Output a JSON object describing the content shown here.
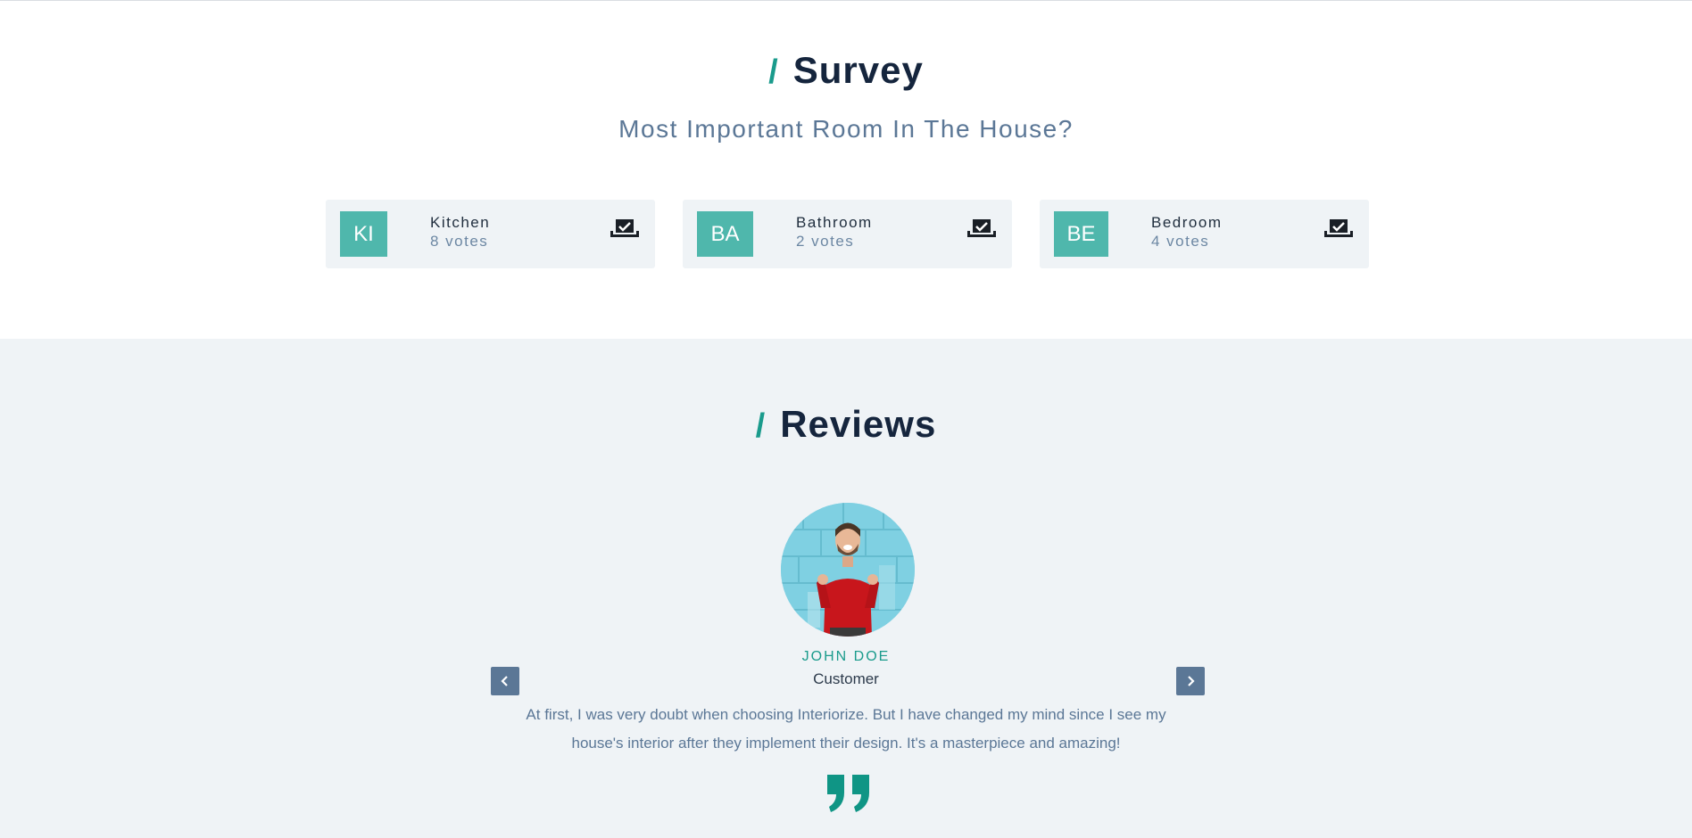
{
  "survey": {
    "slash": "/",
    "title": "Survey",
    "question": "Most Important Room In The House?",
    "options": [
      {
        "initials": "KI",
        "name": "Kitchen",
        "votes": "8 votes"
      },
      {
        "initials": "BA",
        "name": "Bathroom",
        "votes": "2 votes"
      },
      {
        "initials": "BE",
        "name": "Bedroom",
        "votes": "4 votes"
      }
    ]
  },
  "reviews": {
    "slash": "/",
    "title": "Reviews",
    "reviewer": {
      "name": "JOHN DOE",
      "role": "Customer"
    },
    "text": "At first, I was very doubt when choosing Interiorize. But I have changed my mind since I see my house's interior after they implement their design. It's a masterpiece and amazing!"
  },
  "colors": {
    "accent": "#1a9b8c",
    "badge": "#4fb7ac",
    "muted": "#5b7796",
    "dark": "#15253d",
    "panel": "#eff3f6"
  },
  "icons": {
    "vote": "ballot-box-icon",
    "prev": "chevron-left-icon",
    "next": "chevron-right-icon",
    "quote": "quote-icon"
  }
}
